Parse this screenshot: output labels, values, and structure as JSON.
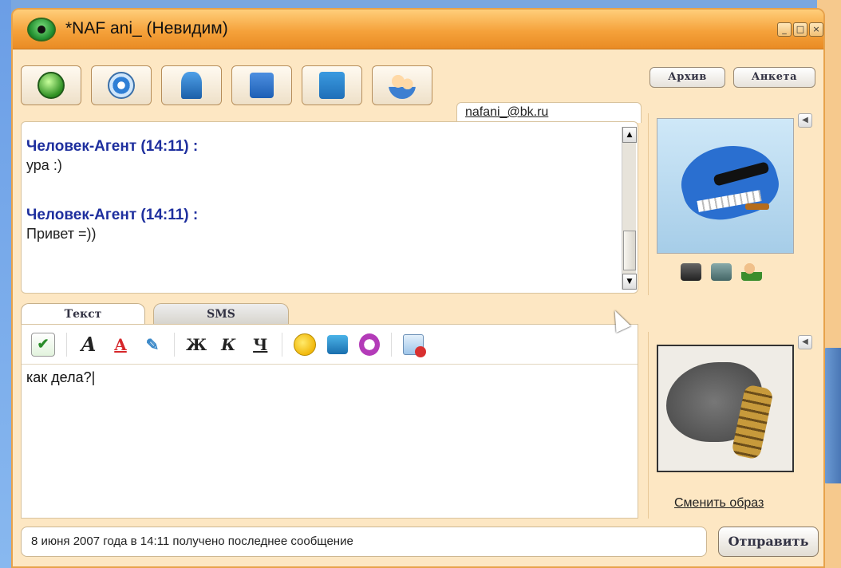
{
  "window": {
    "title": "*NAF ani_ (Невидим)"
  },
  "toolbar": {
    "buttons": [
      {
        "icon": "phone-icon"
      },
      {
        "icon": "webcam-icon"
      },
      {
        "icon": "horse-icon"
      },
      {
        "icon": "save-icon"
      },
      {
        "icon": "transfer-icon"
      },
      {
        "icon": "users-icon"
      }
    ]
  },
  "header_tabs": {
    "archive": "Архив",
    "profile": "Анкета"
  },
  "contact": {
    "email": "nafani_@bk.ru"
  },
  "chat": {
    "messages": [
      {
        "author": "Человек-Агент (14:11) :",
        "text": "ура :)"
      },
      {
        "author": "Человек-Агент (14:11) :",
        "text": "Привет =))"
      }
    ]
  },
  "input_tabs": {
    "text": "Текст",
    "sms": "SMS"
  },
  "format_bar": {
    "bold": "Ж",
    "italic": "К",
    "underline": "Ч"
  },
  "input": {
    "value": "как дела?"
  },
  "side": {
    "change_image": "Сменить образ"
  },
  "status": {
    "text": "8 июня 2007 года в 14:11 получено последнее сообщение"
  },
  "send_button": "Отправить",
  "colors": {
    "accent": "#f5a23b",
    "author": "#1e2f9e",
    "panel_bg": "#fde7c3"
  }
}
